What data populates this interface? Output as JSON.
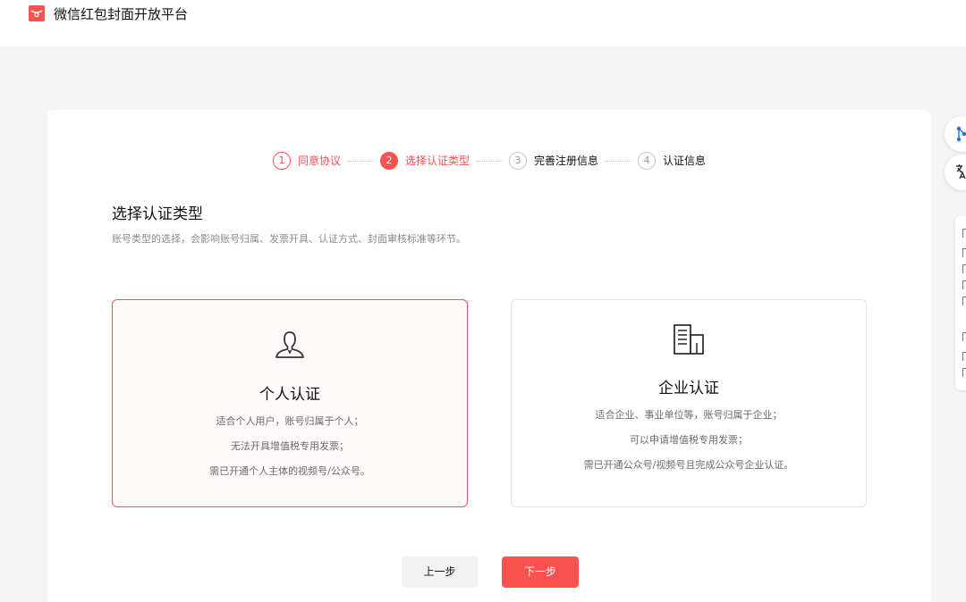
{
  "app": {
    "title": "微信红包封面开放平台"
  },
  "steps": [
    {
      "num": "1",
      "label": "同意协议",
      "state": "done"
    },
    {
      "num": "2",
      "label": "选择认证类型",
      "state": "active"
    },
    {
      "num": "3",
      "label": "完善注册信息",
      "state": "todo"
    },
    {
      "num": "4",
      "label": "认证信息",
      "state": "todo"
    }
  ],
  "section": {
    "title": "选择认证类型",
    "description": "账号类型的选择，会影响账号归属、发票开具、认证方式、封面审核标准等环节。"
  },
  "options": {
    "personal": {
      "title": "个人认证",
      "icon": "person-icon",
      "selected": true,
      "lines": [
        "适合个人用户，账号归属于个人；",
        "无法开具增值税专用发票；",
        "需已开通个人主体的视频号/公众号。"
      ]
    },
    "enterprise": {
      "title": "企业认证",
      "icon": "building-icon",
      "selected": false,
      "lines": [
        "适合企业、事业单位等，账号归属于企业；",
        "可以申请增值税专用发票；",
        "需已开通公众号/视频号且完成公众号企业认证。"
      ]
    }
  },
  "buttons": {
    "prev": "上一步",
    "next": "下一步"
  },
  "colors": {
    "accent": "#fa5151",
    "background": "#f5f5f5",
    "selected_bg": "#fdfaf9"
  }
}
